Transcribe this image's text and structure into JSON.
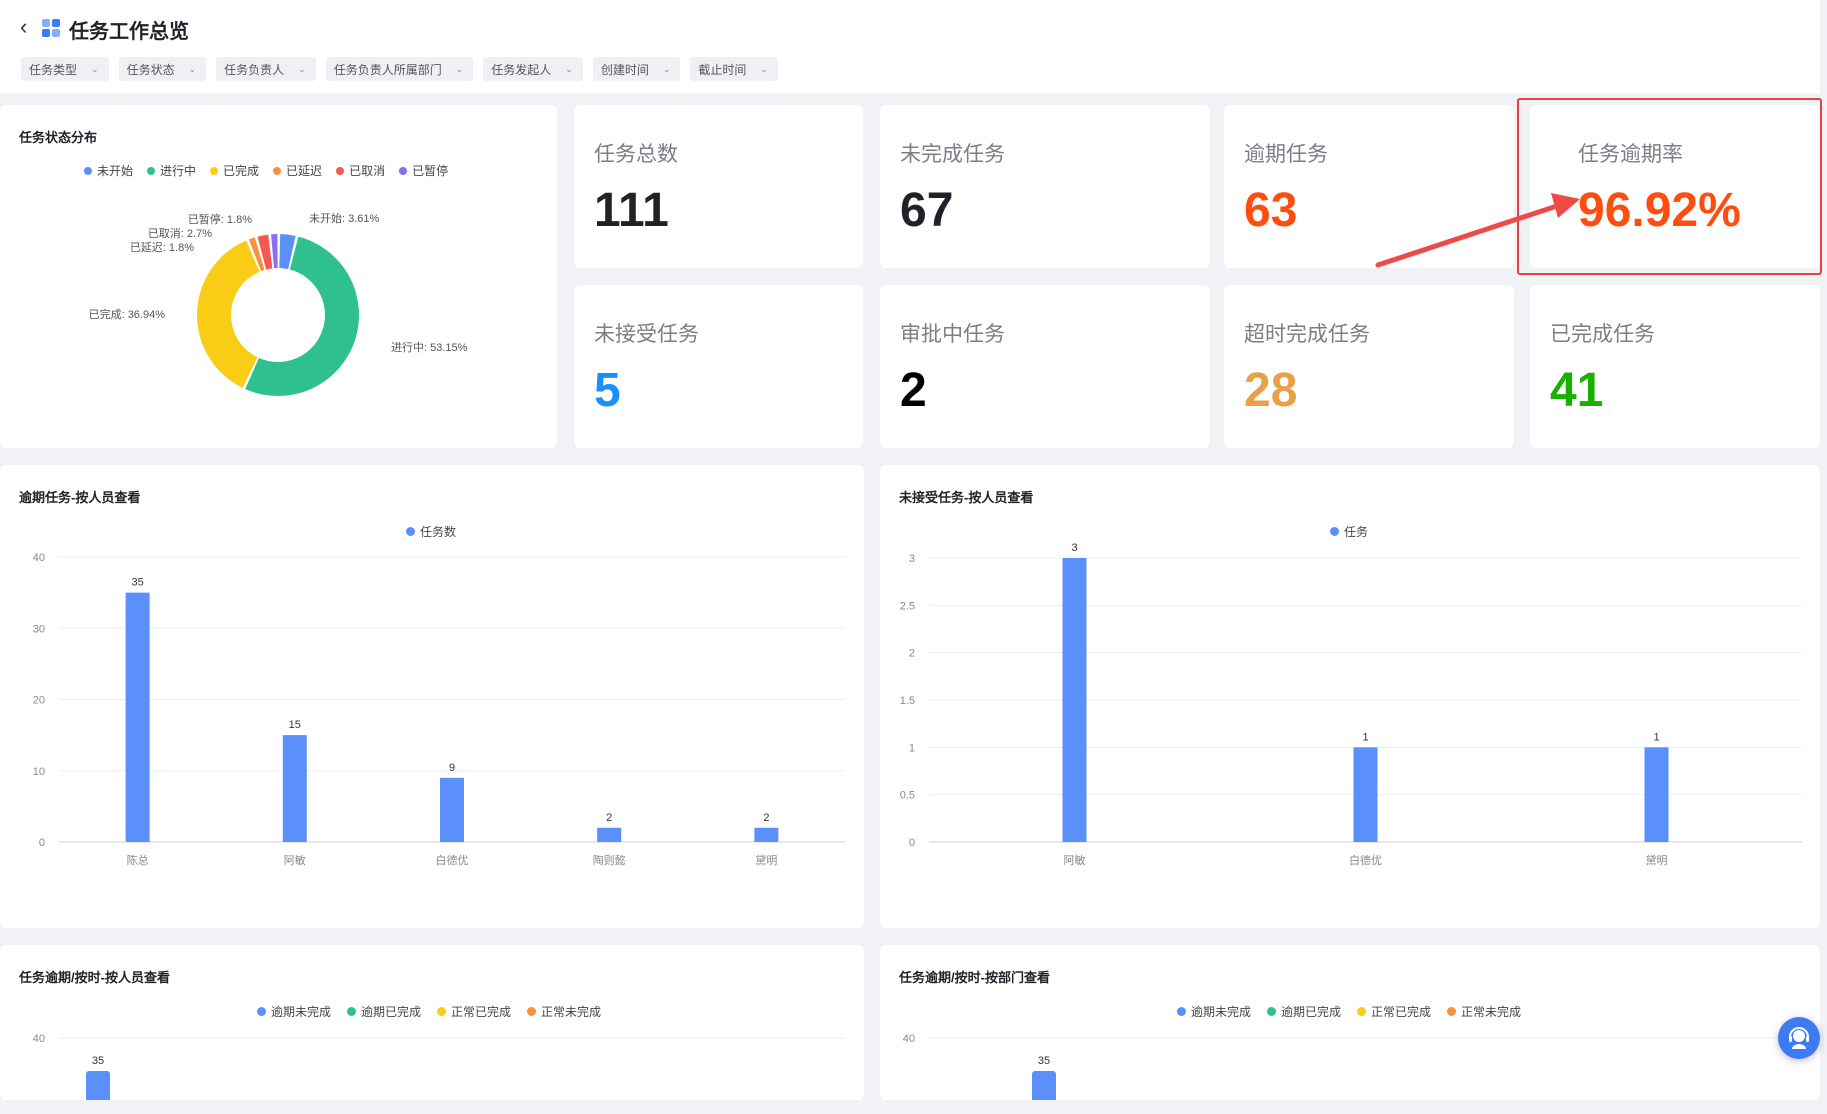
{
  "header": {
    "title": "任务工作总览",
    "filters": [
      "任务类型",
      "任务状态",
      "任务负责人",
      "任务负责人所属部门",
      "任务发起人",
      "创建时间",
      "截止时间"
    ]
  },
  "colors": {
    "blue": "#5b8ff9",
    "green": "#2ec08e",
    "yellow": "#f9cd16",
    "orange": "#f8913d",
    "red": "#f5584f",
    "purple": "#8c6cf1",
    "accent_red": "#ff4d10",
    "kpi_blue": "#1890ff",
    "kpi_orange": "#e9a048",
    "kpi_green": "#19b000"
  },
  "status_card": {
    "title": "任务状态分布",
    "legend": [
      "未开始",
      "进行中",
      "已完成",
      "已延迟",
      "已取消",
      "已暂停"
    ]
  },
  "kpis": [
    {
      "label": "任务总数",
      "value": "111"
    },
    {
      "label": "未完成任务",
      "value": "67"
    },
    {
      "label": "逾期任务",
      "value": "63"
    },
    {
      "label": "任务逾期率",
      "value": "96.92%"
    },
    {
      "label": "未接受任务",
      "value": "5"
    },
    {
      "label": "审批中任务",
      "value": "2"
    },
    {
      "label": "超时完成任务",
      "value": "28"
    },
    {
      "label": "已完成任务",
      "value": "41"
    }
  ],
  "overdue_card": {
    "title": "逾期任务-按人员查看",
    "legend": "任务数"
  },
  "unaccepted_card": {
    "title": "未接受任务-按人员查看",
    "legend": "任务"
  },
  "ontime_person_card": {
    "title": "任务逾期/按时-按人员查看",
    "legend": [
      "逾期未完成",
      "逾期已完成",
      "正常已完成",
      "正常未完成"
    ]
  },
  "ontime_dept_card": {
    "title": "任务逾期/按时-按部门查看",
    "legend": [
      "逾期未完成",
      "逾期已完成",
      "正常已完成",
      "正常未完成"
    ]
  },
  "chart_data": [
    {
      "type": "pie",
      "title": "任务状态分布",
      "slices": [
        {
          "name": "未开始",
          "value": 3.61,
          "label": "未开始: 3.61%",
          "color": "#5b8ff9"
        },
        {
          "name": "进行中",
          "value": 53.15,
          "label": "进行中: 53.15%",
          "color": "#2ec08e"
        },
        {
          "name": "已完成",
          "value": 36.94,
          "label": "已完成: 36.94%",
          "color": "#f9cd16"
        },
        {
          "name": "已延迟",
          "value": 1.8,
          "label": "已延迟: 1.8%",
          "color": "#f8913d"
        },
        {
          "name": "已取消",
          "value": 2.7,
          "label": "已取消: 2.7%",
          "color": "#f5584f"
        },
        {
          "name": "已暂停",
          "value": 1.8,
          "label": "已暂停: 1.8%",
          "color": "#8c6cf1"
        }
      ]
    },
    {
      "type": "bar",
      "title": "逾期任务-按人员查看",
      "categories": [
        "陈总",
        "阿敏",
        "白德优",
        "陶则懿",
        "黛明"
      ],
      "series": [
        {
          "name": "任务数",
          "values": [
            35,
            15,
            9,
            2,
            2
          ]
        }
      ],
      "yticks": [
        "0",
        "10",
        "20",
        "30",
        "40"
      ],
      "ylim": [
        0,
        40
      ],
      "grid": true
    },
    {
      "type": "bar",
      "title": "未接受任务-按人员查看",
      "categories": [
        "阿敏",
        "白德优",
        "黛明"
      ],
      "series": [
        {
          "name": "任务",
          "values": [
            3,
            1,
            1
          ]
        }
      ],
      "yticks": [
        "0",
        "0.5",
        "1",
        "1.5",
        "2",
        "2.5",
        "3"
      ],
      "ylim": [
        0,
        3
      ],
      "grid": true
    },
    {
      "type": "bar",
      "title": "任务逾期/按时-按人员查看",
      "visible_ytick": "40",
      "ylim": [
        0,
        40
      ],
      "visible_bar_label": "35"
    },
    {
      "type": "bar",
      "title": "任务逾期/按时-按部门查看",
      "visible_ytick": "40",
      "ylim": [
        0,
        40
      ],
      "visible_bar_label": "35"
    }
  ]
}
